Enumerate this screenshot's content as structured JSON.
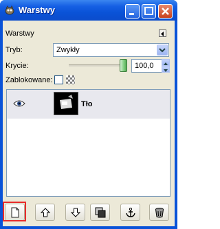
{
  "window": {
    "title": "Warstwy"
  },
  "panel": {
    "header": "Warstwy",
    "mode_label": "Tryb:",
    "mode_value": "Zwykły",
    "opacity_label": "Krycie:",
    "opacity_value": "100,0",
    "opacity_level": 1.0,
    "locked_label": "Zablokowane:",
    "lock_pixels_checked": false
  },
  "layers": [
    {
      "name": "Tło",
      "visible": true
    }
  ],
  "toolbar": {
    "buttons": [
      "new-layer",
      "raise-layer",
      "lower-layer",
      "duplicate-layer",
      "anchor-layer",
      "delete-layer"
    ],
    "highlighted": "new-layer"
  },
  "colors": {
    "title_bar": "#0a53d8",
    "window_bg": "#ece9d8",
    "close_button": "#c8411d",
    "highlight": "#e82b2b",
    "slider_thumb": "#7ccc7c"
  }
}
